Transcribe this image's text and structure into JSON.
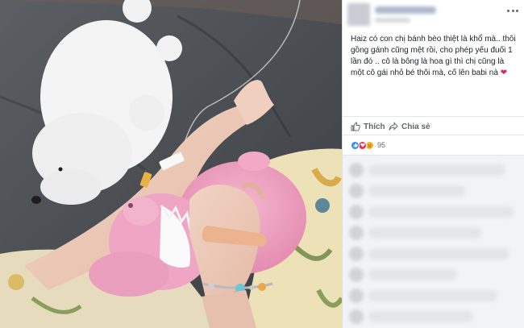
{
  "post": {
    "caption_text": "Haiz có con chị bánh bèo thiệt là khổ mà.. thôi gồng gánh cũng mệt rồi, cho phép yếu đuối 1 lần đó .. cô là bông là hoa gì thì chị cũng là một cô gái nhỏ bé thôi mà, cố lên babi nà",
    "caption_emoji": "❤",
    "actions": {
      "like_label": "Thích",
      "share_label": "Chia sẻ"
    },
    "reactions": {
      "types": [
        "like-icon",
        "love-icon",
        "sad-icon"
      ],
      "count": "95"
    },
    "comments_blurred": 8
  },
  "colors": {
    "accent": "#4267b2",
    "like": "#2d88ff",
    "love": "#f0284a",
    "sad": "#f7b125",
    "heart": "#e0245e"
  }
}
